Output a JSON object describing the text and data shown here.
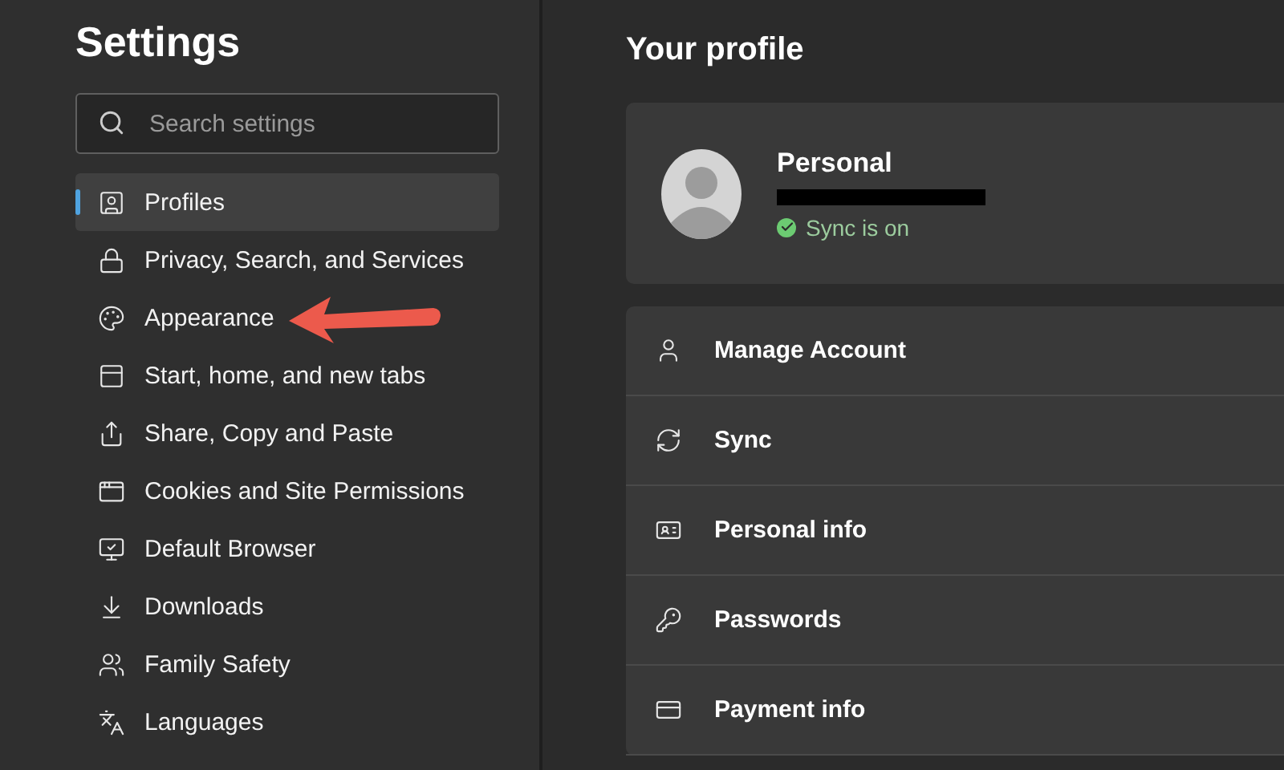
{
  "sidebar": {
    "title": "Settings",
    "search": {
      "placeholder": "Search settings"
    },
    "items": [
      {
        "label": "Profiles",
        "selected": true
      },
      {
        "label": "Privacy, Search, and Services",
        "selected": false
      },
      {
        "label": "Appearance",
        "selected": false
      },
      {
        "label": "Start, home, and new tabs",
        "selected": false
      },
      {
        "label": "Share, Copy and Paste",
        "selected": false
      },
      {
        "label": "Cookies and Site Permissions",
        "selected": false
      },
      {
        "label": "Default Browser",
        "selected": false
      },
      {
        "label": "Downloads",
        "selected": false
      },
      {
        "label": "Family Safety",
        "selected": false
      },
      {
        "label": "Languages",
        "selected": false
      }
    ]
  },
  "main": {
    "title": "Your profile",
    "profile": {
      "name": "Personal",
      "sync_status": "Sync is on",
      "sync_on": true
    },
    "rows": [
      {
        "label": "Manage Account"
      },
      {
        "label": "Sync"
      },
      {
        "label": "Personal info"
      },
      {
        "label": "Passwords"
      },
      {
        "label": "Payment info"
      }
    ]
  }
}
